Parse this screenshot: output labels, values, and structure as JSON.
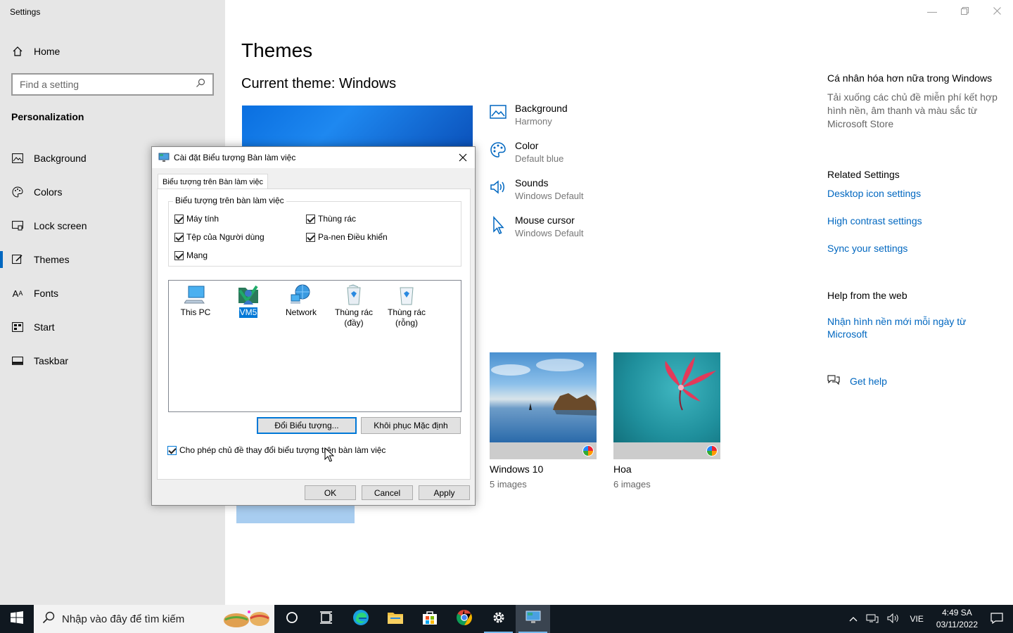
{
  "app": {
    "title": "Settings"
  },
  "sidebar": {
    "home_label": "Home",
    "search_placeholder": "Find a setting",
    "section_title": "Personalization",
    "items": [
      {
        "label": "Background",
        "icon": "image-icon"
      },
      {
        "label": "Colors",
        "icon": "palette-icon"
      },
      {
        "label": "Lock screen",
        "icon": "lock-screen-icon"
      },
      {
        "label": "Themes",
        "icon": "brush-icon",
        "active": true
      },
      {
        "label": "Fonts",
        "icon": "font-icon"
      },
      {
        "label": "Start",
        "icon": "start-icon"
      },
      {
        "label": "Taskbar",
        "icon": "taskbar-icon"
      }
    ]
  },
  "main": {
    "title": "Themes",
    "current_theme": "Current theme: Windows",
    "properties": [
      {
        "name": "Background",
        "value": "Harmony",
        "icon": "picture-icon"
      },
      {
        "name": "Color",
        "value": "Default blue",
        "icon": "palette-icon"
      },
      {
        "name": "Sounds",
        "value": "Windows Default",
        "icon": "speaker-icon"
      },
      {
        "name": "Mouse cursor",
        "value": "Windows Default",
        "icon": "cursor-icon"
      }
    ],
    "themes": [
      {
        "name": "Windows 10",
        "count": "5 images"
      },
      {
        "name": "Hoa",
        "count": "6 images"
      }
    ]
  },
  "right": {
    "promo_title": "Cá nhân hóa hơn nữa trong Windows",
    "promo_desc": "Tải xuống các chủ đề miễn phí kết hợp hình nền, âm thanh và màu sắc từ Microsoft Store",
    "related_title": "Related Settings",
    "related_links": [
      "Desktop icon settings",
      "High contrast settings",
      "Sync your settings"
    ],
    "help_title": "Help from the web",
    "help_link": "Nhận hình nền mới mỗi ngày từ Microsoft",
    "get_help": "Get help"
  },
  "dialog": {
    "title": "Cài đặt Biểu tượng Bàn làm việc",
    "tab": "Biểu tượng trên Bàn làm việc",
    "group_title": "Biểu tượng trên bàn làm việc",
    "checkboxes": [
      {
        "label": "Máy tính",
        "checked": true
      },
      {
        "label": "Thùng rác",
        "checked": true
      },
      {
        "label": "Tệp của Người dùng",
        "checked": true
      },
      {
        "label": "Pa-nen Điều khiển",
        "checked": true
      },
      {
        "label": "Mạng",
        "checked": true
      }
    ],
    "icons": [
      {
        "line1": "This PC",
        "line2": ""
      },
      {
        "line1": "VM5",
        "line2": "",
        "selected": true
      },
      {
        "line1": "Network",
        "line2": ""
      },
      {
        "line1": "Thùng rác",
        "line2": "(đầy)"
      },
      {
        "line1": "Thùng rác",
        "line2": "(rỗng)"
      }
    ],
    "change_icon_btn": "Đổi Biểu tượng...",
    "restore_default_btn": "Khôi phục Mặc định",
    "allow_themes_label": "Cho phép chủ đề thay đổi biểu tượng trên bàn làm việc",
    "ok": "OK",
    "cancel": "Cancel",
    "apply": "Apply"
  },
  "taskbar": {
    "search_placeholder": "Nhập vào đây để tìm kiếm",
    "language": "VIE",
    "time": "4:49 SA",
    "date": "03/11/2022"
  }
}
